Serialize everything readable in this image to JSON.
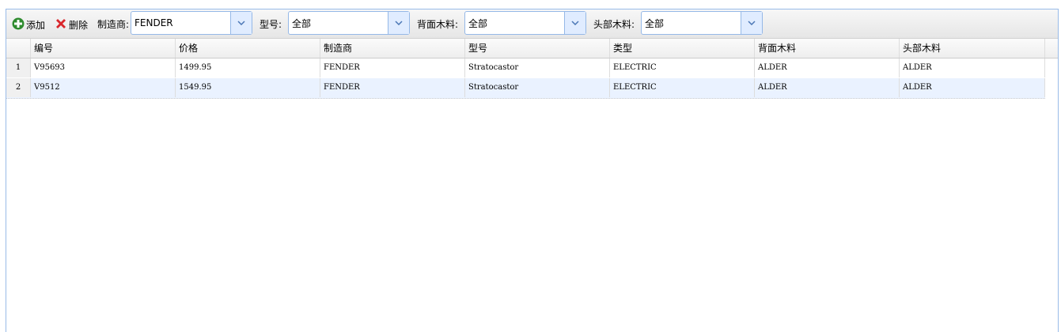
{
  "toolbar": {
    "add_label": "添加",
    "delete_label": "删除",
    "manufacturer_label": "制造商:",
    "manufacturer_value": "FENDER",
    "model_label": "型号:",
    "model_value": "全部",
    "back_wood_label": "背面木料:",
    "back_wood_value": "全部",
    "top_wood_label": "头部木料:",
    "top_wood_value": "全部"
  },
  "table": {
    "columns": [
      "编号",
      "价格",
      "制造商",
      "型号",
      "类型",
      "背面木料",
      "头部木料"
    ],
    "rows": [
      {
        "num": "1",
        "cells": [
          "V95693",
          "1499.95",
          "FENDER",
          "Stratocastor",
          "ELECTRIC",
          "ALDER",
          "ALDER"
        ]
      },
      {
        "num": "2",
        "cells": [
          "V9512",
          "1549.95",
          "FENDER",
          "Stratocastor",
          "ELECTRIC",
          "ALDER",
          "ALDER"
        ]
      }
    ]
  },
  "colors": {
    "border": "#99bbe8",
    "selected_row": "#eaf2ff",
    "add_icon": "#2e8b2e",
    "delete_icon": "#d9262b"
  }
}
